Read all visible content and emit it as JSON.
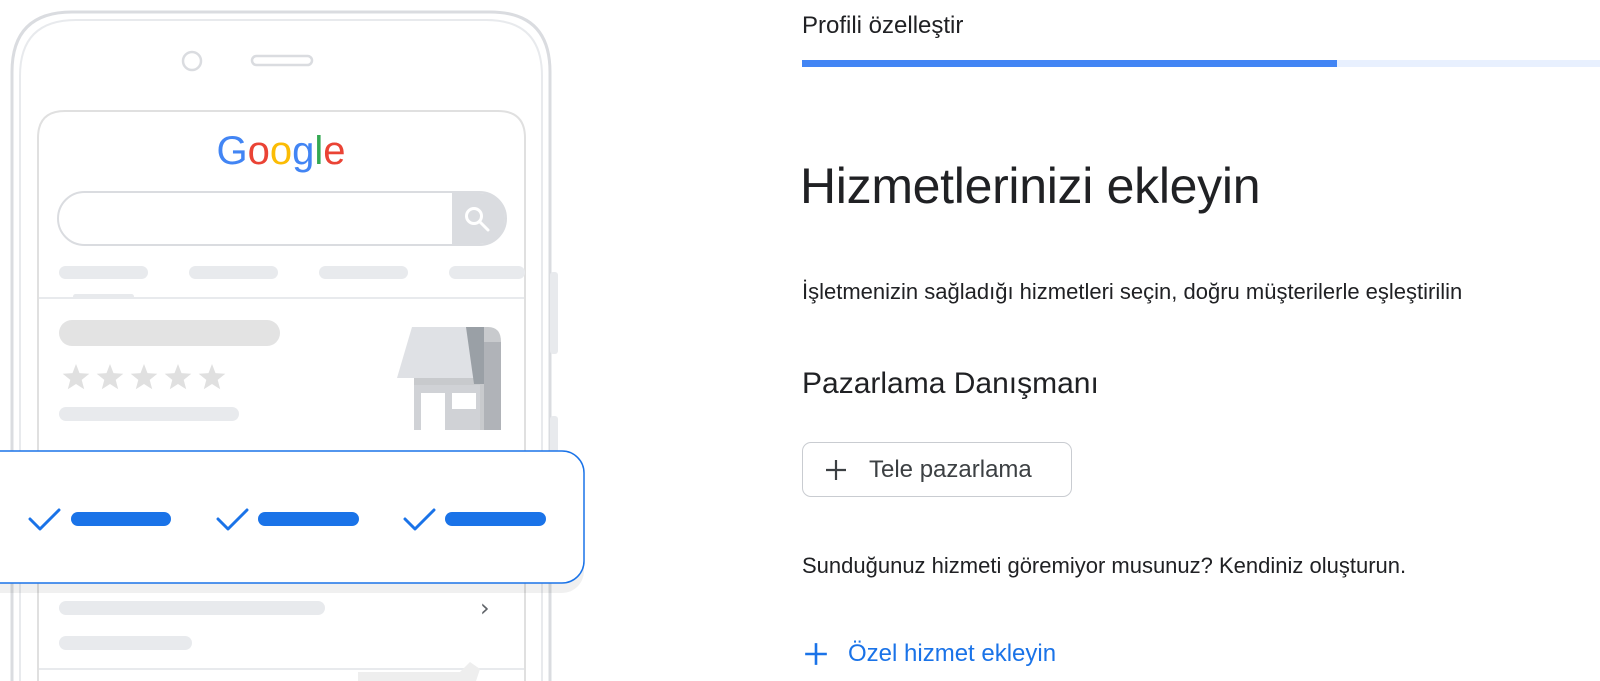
{
  "header": {
    "step_title": "Profili özelleştir"
  },
  "progress": {
    "fraction": 0.67
  },
  "main": {
    "title": "Hizmetlerinizi ekleyin",
    "subtitle": "İşletmenizin sağladığı hizmetleri seçin, doğru müşterilerle eşleştirilin",
    "category": "Pazarlama Danışmanı",
    "service_chips": [
      {
        "label": "Tele pazarlama",
        "icon": "plus-icon"
      }
    ],
    "hint": "Sunduğunuz hizmeti göremiyor musunuz? Kendiniz oluşturun.",
    "add_custom_label": "Özel hizmet ekleyin"
  },
  "illustration": {
    "logo_text": "Google",
    "logo_colors": [
      "#4285F4",
      "#EA4335",
      "#FBBC05",
      "#4285F4",
      "#34A853",
      "#EA4335"
    ],
    "rating_stars": 5
  },
  "colors": {
    "accent": "#1a73e8",
    "progress_fill": "#4285f4",
    "progress_track": "#e8f0fe"
  }
}
